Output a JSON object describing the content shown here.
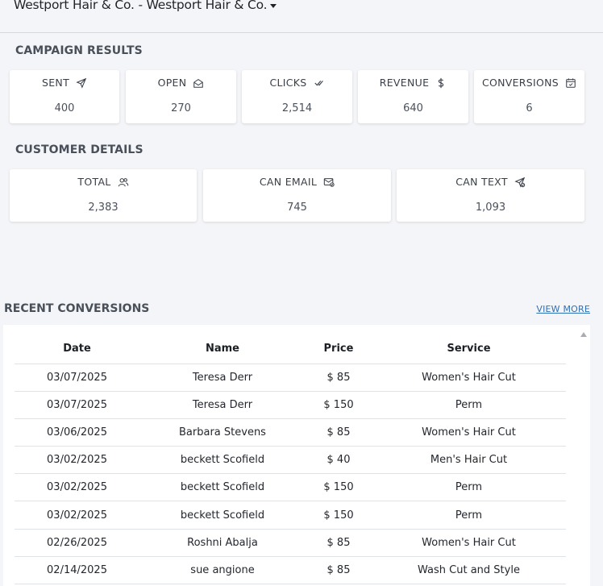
{
  "header": {
    "business_select": "Westport Hair & Co. - Westport Hair & Co."
  },
  "campaign": {
    "title": "CAMPAIGN RESULTS",
    "cards": [
      {
        "label": "SENT",
        "value": "400",
        "icon": "send-icon"
      },
      {
        "label": "OPEN",
        "value": "270",
        "icon": "envelope-open-icon"
      },
      {
        "label": "CLICKS",
        "value": "2,514",
        "icon": "double-check-icon"
      },
      {
        "label": "REVENUE",
        "value": "640",
        "icon": "dollar-icon"
      },
      {
        "label": "CONVERSIONS",
        "value": "6",
        "icon": "calendar-check-icon"
      }
    ]
  },
  "customers": {
    "title": "CUSTOMER DETAILS",
    "cards": [
      {
        "label": "TOTAL",
        "value": "2,383",
        "icon": "users-icon"
      },
      {
        "label": "CAN EMAIL",
        "value": "745",
        "icon": "email-check-icon"
      },
      {
        "label": "CAN TEXT",
        "value": "1,093",
        "icon": "send-check-icon"
      }
    ]
  },
  "recent": {
    "title": "RECENT CONVERSIONS",
    "view_more": "VIEW MORE",
    "columns": [
      "Date",
      "Name",
      "Price",
      "Service"
    ],
    "rows": [
      [
        "03/07/2025",
        "Teresa Derr",
        "$ 85",
        "Women's Hair Cut"
      ],
      [
        "03/07/2025",
        "Teresa Derr",
        "$ 150",
        "Perm"
      ],
      [
        "03/06/2025",
        "Barbara Stevens",
        "$ 85",
        "Women's Hair Cut"
      ],
      [
        "03/02/2025",
        "beckett Scofield",
        "$ 40",
        "Men's Hair Cut"
      ],
      [
        "03/02/2025",
        "beckett Scofield",
        "$ 150",
        "Perm"
      ],
      [
        "03/02/2025",
        "beckett Scofield",
        "$ 150",
        "Perm"
      ],
      [
        "02/26/2025",
        "Roshni Abalja",
        "$ 85",
        "Women's Hair Cut"
      ],
      [
        "02/14/2025",
        "sue angione",
        "$ 85",
        "Wash Cut and Style"
      ]
    ]
  },
  "colors": {
    "background": "#f4f5f8",
    "link": "#2f6fb3",
    "card": "#ffffff"
  }
}
